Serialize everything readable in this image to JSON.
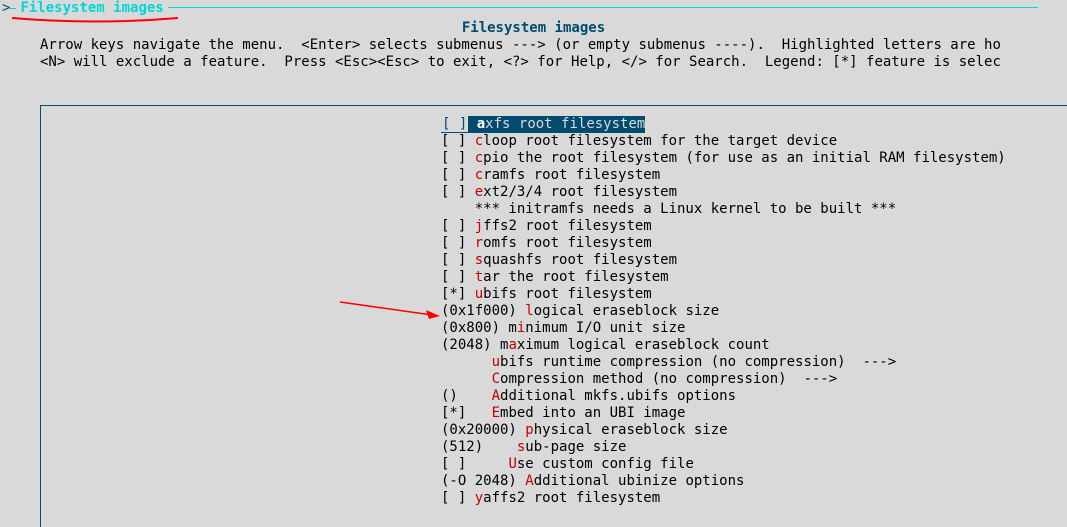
{
  "outer_title": "Filesystem images",
  "inner_title": "Filesystem images",
  "help_line1": "Arrow keys navigate the menu.  <Enter> selects submenus ---> (or empty submenus ----).  Highlighted letters are ho",
  "help_line2": "<N> will exclude a feature.  Press <Esc><Esc> to exit, <?> for Help, </> for Search.  Legend: [*] feature is selec",
  "colors": {
    "accent": "#004b6e",
    "title": "#00d7d7",
    "hotkey": "#c40000",
    "annotation": "#ff0000",
    "bg": "#d9d9d9"
  },
  "menu": [
    {
      "box": "[ ]",
      "pre": "",
      "hot": "a",
      "post": "xfs root filesystem",
      "selected": true
    },
    {
      "box": "[ ]",
      "pre": "",
      "hot": "c",
      "post": "loop root filesystem for the target device"
    },
    {
      "box": "[ ]",
      "pre": "",
      "hot": "c",
      "post": "pio the root filesystem (for use as an initial RAM filesystem)"
    },
    {
      "box": "[ ]",
      "pre": "",
      "hot": "c",
      "post": "ramfs root filesystem"
    },
    {
      "box": "[ ]",
      "pre": "",
      "hot": "e",
      "post": "xt2/3/4 root filesystem"
    },
    {
      "box": "   ",
      "pre": "*** initramfs needs a Linux kernel to be built ***",
      "hot": "",
      "post": ""
    },
    {
      "box": "[ ]",
      "pre": "",
      "hot": "j",
      "post": "ffs2 root filesystem"
    },
    {
      "box": "[ ]",
      "pre": "",
      "hot": "r",
      "post": "omfs root filesystem"
    },
    {
      "box": "[ ]",
      "pre": "",
      "hot": "s",
      "post": "quashfs root filesystem"
    },
    {
      "box": "[ ]",
      "pre": "",
      "hot": "t",
      "post": "ar the root filesystem"
    },
    {
      "box": "[*]",
      "pre": "",
      "hot": "u",
      "post": "bifs root filesystem"
    },
    {
      "box": "(0x1f000)",
      "pre": "",
      "hot": "l",
      "post": "ogical eraseblock size"
    },
    {
      "box": "(0x800)",
      "pre": "m",
      "hot": "i",
      "post": "nimum I/O unit size"
    },
    {
      "box": "(2048)",
      "pre": "m",
      "hot": "a",
      "post": "ximum logical eraseblock count"
    },
    {
      "box": "   ",
      "pre": "  ",
      "hot": "u",
      "post": "bifs runtime compression (no compression)  --->"
    },
    {
      "box": "   ",
      "pre": "  ",
      "hot": "C",
      "post": "ompression method (no compression)  --->"
    },
    {
      "box": "() ",
      "pre": "  ",
      "hot": "A",
      "post": "dditional mkfs.ubifs options"
    },
    {
      "box": "[*]",
      "pre": "  ",
      "hot": "E",
      "post": "mbed into an UBI image"
    },
    {
      "box": "(0x20000)",
      "pre": "",
      "hot": "p",
      "post": "hysical eraseblock size"
    },
    {
      "box": "(512)",
      "pre": "   ",
      "hot": "s",
      "post": "ub-page size"
    },
    {
      "box": "[ ]",
      "pre": "    ",
      "hot": "U",
      "post": "se custom config file"
    },
    {
      "box": "(-O 2048)",
      "pre": "",
      "hot": "A",
      "post": "dditional ubinize options"
    },
    {
      "box": "[ ]",
      "pre": "",
      "hot": "y",
      "post": "affs2 root filesystem"
    }
  ]
}
